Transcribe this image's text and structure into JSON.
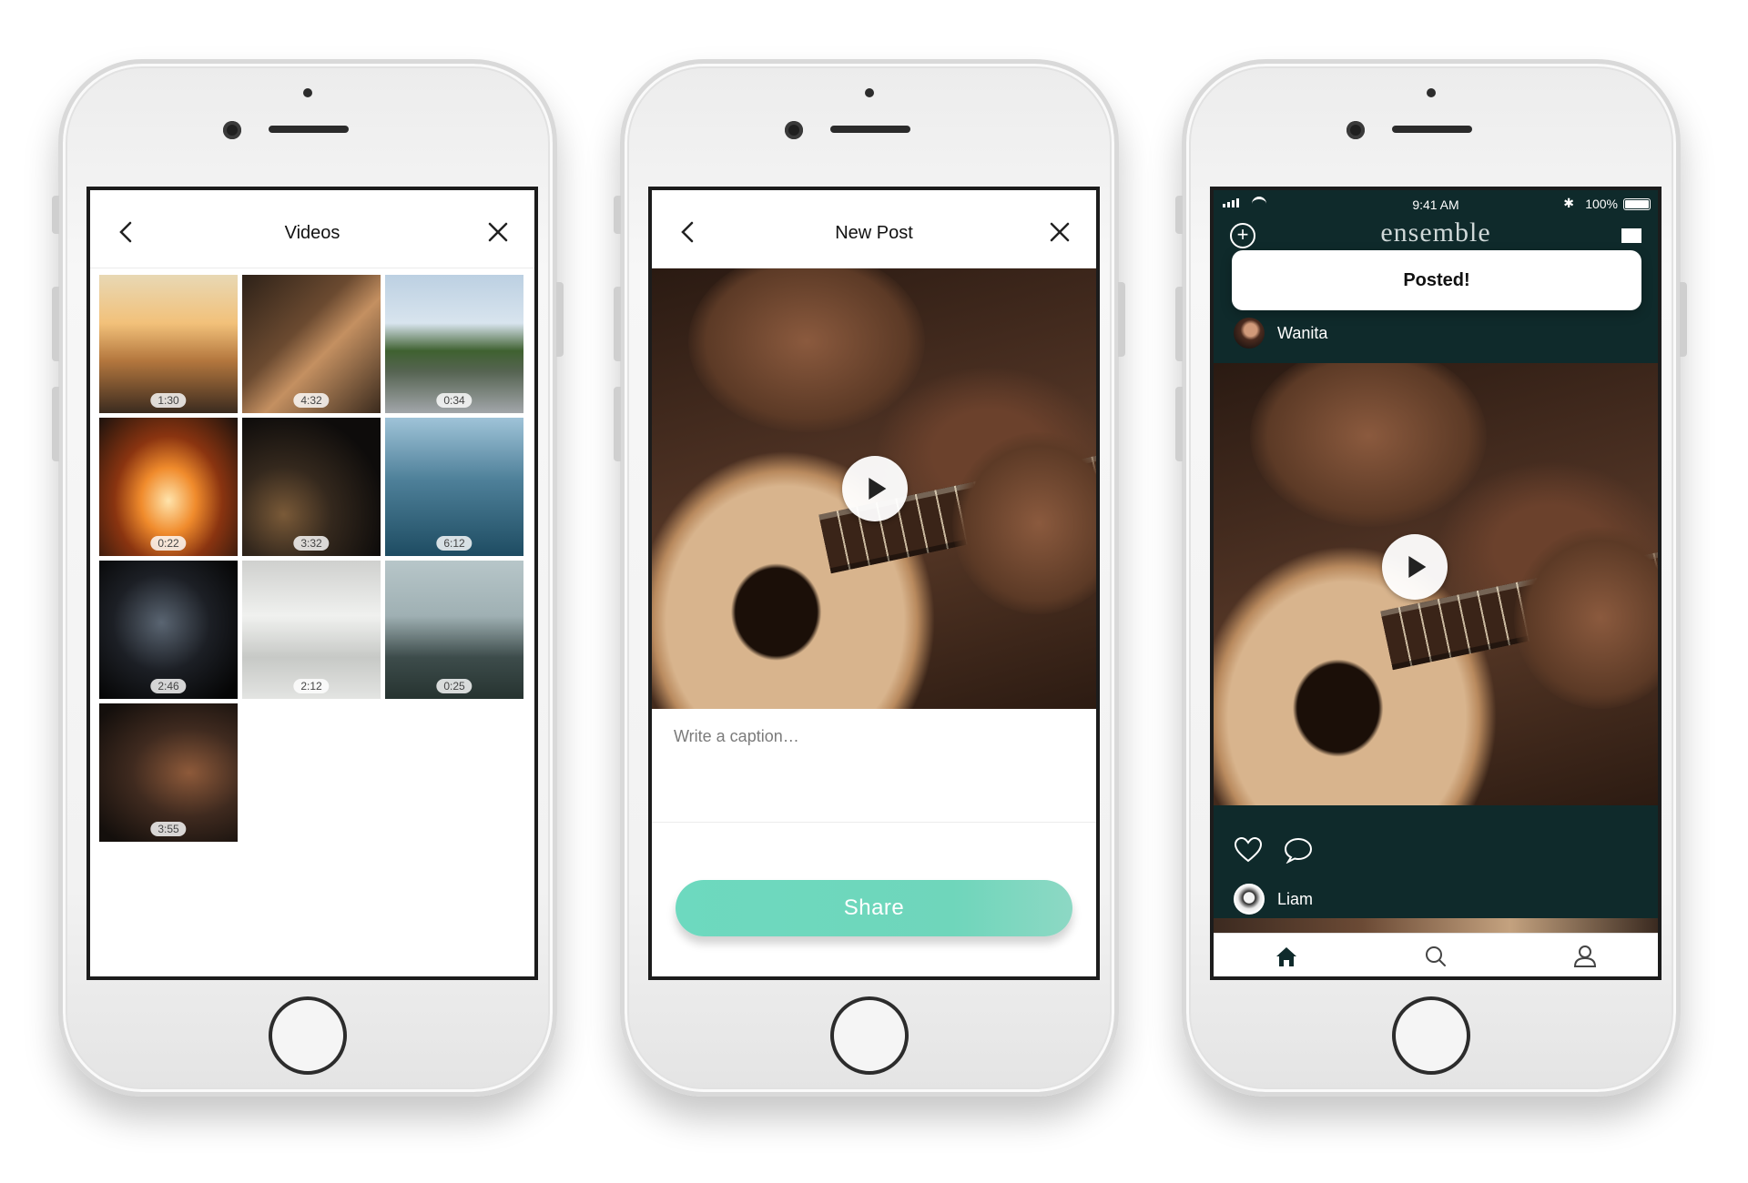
{
  "screen_videos": {
    "title": "Videos",
    "videos": [
      {
        "duration": "1:30"
      },
      {
        "duration": "4:32"
      },
      {
        "duration": "0:34"
      },
      {
        "duration": "0:22"
      },
      {
        "duration": "3:32"
      },
      {
        "duration": "6:12"
      },
      {
        "duration": "2:46"
      },
      {
        "duration": "2:12"
      },
      {
        "duration": "0:25"
      },
      {
        "duration": "3:55"
      }
    ]
  },
  "screen_new_post": {
    "title": "New Post",
    "caption_placeholder": "Write a caption…",
    "share_label": "Share"
  },
  "screen_feed": {
    "status": {
      "time": "9:41 AM",
      "battery": "100%"
    },
    "app_name": "ensemble",
    "toast": "Posted!",
    "post_user": "Wanita",
    "next_user": "Liam"
  },
  "colors": {
    "accent": "#6dd9bf",
    "feed_background": "#0f2a2b"
  }
}
